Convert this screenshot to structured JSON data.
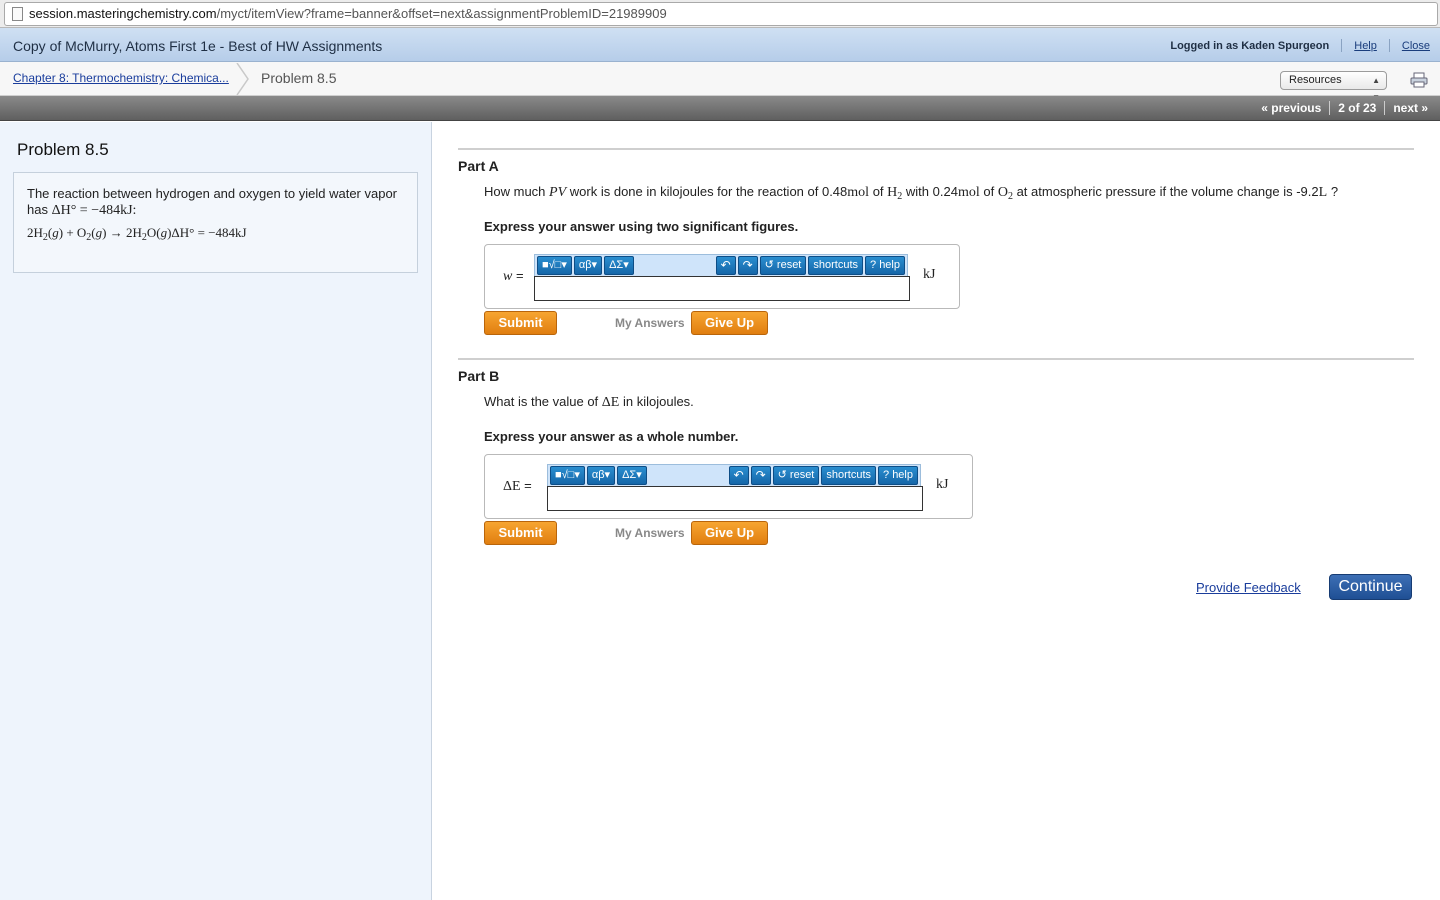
{
  "browser": {
    "url_domain": "session.masteringchemistry.com",
    "url_path": "/myct/itemView?frame=banner&offset=next&assignmentProblemID=21989909"
  },
  "banner": {
    "course_title": "Copy of McMurry, Atoms First 1e - Best of HW Assignments",
    "login_text": "Logged in as Kaden Spurgeon",
    "help_link": "Help",
    "close_link": "Close"
  },
  "breadcrumb": {
    "chapter": "Chapter 8: Thermochemistry: Chemica...",
    "problem": "Problem 8.5",
    "resources_label": "Resources"
  },
  "nav": {
    "previous": "« previous",
    "position": "2 of 23",
    "next": "next »"
  },
  "left": {
    "title": "Problem 8.5",
    "intro": "The reaction between hydrogen and oxygen to yield water vapor has",
    "enthalpy": "ΔH° = −484kJ:",
    "equation_dh": "ΔH° = −484kJ"
  },
  "partA": {
    "title": "Part A",
    "q_pre": "How much",
    "q_pv": "PV",
    "q_mid1": "work is done in kilojoules for the reaction of 0.48",
    "q_mol": "mol",
    "q_of": "of",
    "q_with": "with 0.24",
    "q_mid2": "at atmospheric pressure if the volume change is -9.2",
    "q_l": "L",
    "q_end": "?",
    "instruction": "Express your answer using two significant figures.",
    "variable": "w",
    "unit": "kJ"
  },
  "partB": {
    "title": "Part B",
    "q_pre": "What is the value of",
    "q_var": "ΔE",
    "q_end": "in kilojoules.",
    "instruction": "Express your answer as a whole number.",
    "variable": "ΔE",
    "unit": "kJ"
  },
  "toolbar": {
    "templates": "■√□▾",
    "greek": "αβ▾",
    "symbols": "ΔΣ▾",
    "undo": "↶",
    "redo": "↷",
    "reset": "↺ reset",
    "shortcuts": "shortcuts",
    "help": "? help"
  },
  "buttons": {
    "submit": "Submit",
    "my_answers": "My Answers",
    "give_up": "Give Up",
    "provide_feedback": "Provide Feedback",
    "continue": "Continue"
  }
}
